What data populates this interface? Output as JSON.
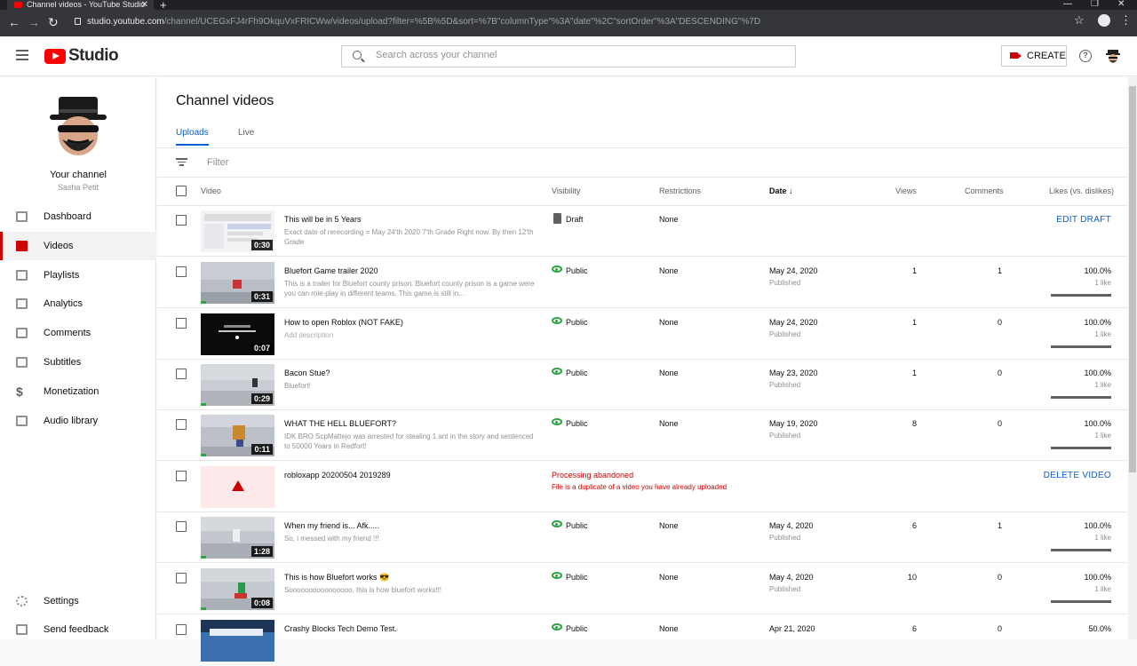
{
  "browser": {
    "tab_title": "Channel videos - YouTube Studio",
    "url_host": "studio.youtube.com",
    "url_path": "/channel/UCEGxFJ4rFh9OkquVxFRICWw/videos/upload?filter=%5B%5D&sort=%7B\"columnType\"%3A\"date\"%2C\"sortOrder\"%3A\"DESCENDING\"%7D"
  },
  "header": {
    "logo_text": "Studio",
    "search_placeholder": "Search across your channel",
    "create_label": "CREATE"
  },
  "sidebar": {
    "channel_label": "Your channel",
    "channel_name": "Sasha Petit",
    "items": [
      {
        "label": "Dashboard",
        "icon": "dashboard-icon"
      },
      {
        "label": "Videos",
        "icon": "videos-icon",
        "active": true
      },
      {
        "label": "Playlists",
        "icon": "playlists-icon"
      },
      {
        "label": "Analytics",
        "icon": "analytics-icon"
      },
      {
        "label": "Comments",
        "icon": "comments-icon"
      },
      {
        "label": "Subtitles",
        "icon": "subtitles-icon"
      },
      {
        "label": "Monetization",
        "icon": "dollar-icon"
      },
      {
        "label": "Audio library",
        "icon": "audio-library-icon"
      }
    ],
    "bottom_items": [
      {
        "label": "Settings",
        "icon": "gear-icon"
      },
      {
        "label": "Send feedback",
        "icon": "feedback-icon"
      }
    ]
  },
  "main": {
    "title": "Channel videos",
    "tabs": [
      "Uploads",
      "Live"
    ],
    "filter_placeholder": "Filter",
    "columns": [
      "Video",
      "Visibility",
      "Restrictions",
      "Date",
      "Views",
      "Comments",
      "Likes (vs. dislikes)"
    ],
    "sort_indicator": "↓",
    "colors": {
      "accent": "#065fd4",
      "brand": "#ff0000",
      "public": "#2ba640",
      "error": "#cc0000"
    },
    "rows": [
      {
        "title": "This will be in 5 Years",
        "desc": "Exact date of rerecording = May 24'th 2020 7'th Grade Right now. By then 12'th Grade",
        "duration": "0:30",
        "visibility": "Draft",
        "restrictions": "None",
        "action": "EDIT DRAFT"
      },
      {
        "title": "Bluefort Game trailer 2020",
        "desc": "This is a trailer for Bluefort county prison. Bluefort county prison is a game were you can role-play in different teams. This game is still in...",
        "duration": "0:31",
        "visibility": "Public",
        "restrictions": "None",
        "date": "May 24, 2020",
        "status": "Published",
        "views": "1",
        "comments": "1",
        "likes_pct": "100.0%",
        "likes_sub": "1 like",
        "likes_ratio": 1.0
      },
      {
        "title": "How to open Roblox (NOT FAKE)",
        "desc": "Add description",
        "duration": "0:07",
        "visibility": "Public",
        "restrictions": "None",
        "date": "May 24, 2020",
        "status": "Published",
        "views": "1",
        "comments": "0",
        "likes_pct": "100.0%",
        "likes_sub": "1 like",
        "likes_ratio": 1.0
      },
      {
        "title": "Bacon Stue?",
        "desc": "Bluefort!",
        "duration": "0:29",
        "visibility": "Public",
        "restrictions": "None",
        "date": "May 23, 2020",
        "status": "Published",
        "views": "1",
        "comments": "0",
        "likes_pct": "100.0%",
        "likes_sub": "1 like",
        "likes_ratio": 1.0
      },
      {
        "title": "WHAT THE HELL BLUEFORT?",
        "desc": "IDK BRO ScpMattejo was arrested for stealing 1 ant in the story and sentenced to 50000 Years in Redfort!",
        "duration": "0:11",
        "visibility": "Public",
        "restrictions": "None",
        "date": "May 19, 2020",
        "status": "Published",
        "views": "8",
        "comments": "0",
        "likes_pct": "100.0%",
        "likes_sub": "1 like",
        "likes_ratio": 1.0
      },
      {
        "title": "robloxapp 20200504 2019289",
        "error_title": "Processing abandoned",
        "error_desc": "File is a duplicate of a video you have already uploaded",
        "action": "DELETE VIDEO"
      },
      {
        "title": "When my friend is... Afk.....",
        "desc": "So, i messed with my friend !!!",
        "duration": "1:28",
        "visibility": "Public",
        "restrictions": "None",
        "date": "May 4, 2020",
        "status": "Published",
        "views": "6",
        "comments": "1",
        "likes_pct": "100.0%",
        "likes_sub": "1 like",
        "likes_ratio": 1.0
      },
      {
        "title": "This is how Bluefort works 😎",
        "desc": "Soooooooooooooooo, this is how bluefort works!!!",
        "duration": "0:08",
        "visibility": "Public",
        "restrictions": "None",
        "date": "May 4, 2020",
        "status": "Published",
        "views": "10",
        "comments": "0",
        "likes_pct": "100.0%",
        "likes_sub": "1 like",
        "likes_ratio": 1.0
      },
      {
        "title": "Crashy Blocks Tech Demo Test.",
        "desc": "",
        "duration": "",
        "visibility": "Public",
        "restrictions": "None",
        "date": "Apr 21, 2020",
        "status": "",
        "views": "6",
        "comments": "0",
        "likes_pct": "50.0%",
        "likes_sub": "",
        "likes_ratio": 0.5
      }
    ]
  }
}
